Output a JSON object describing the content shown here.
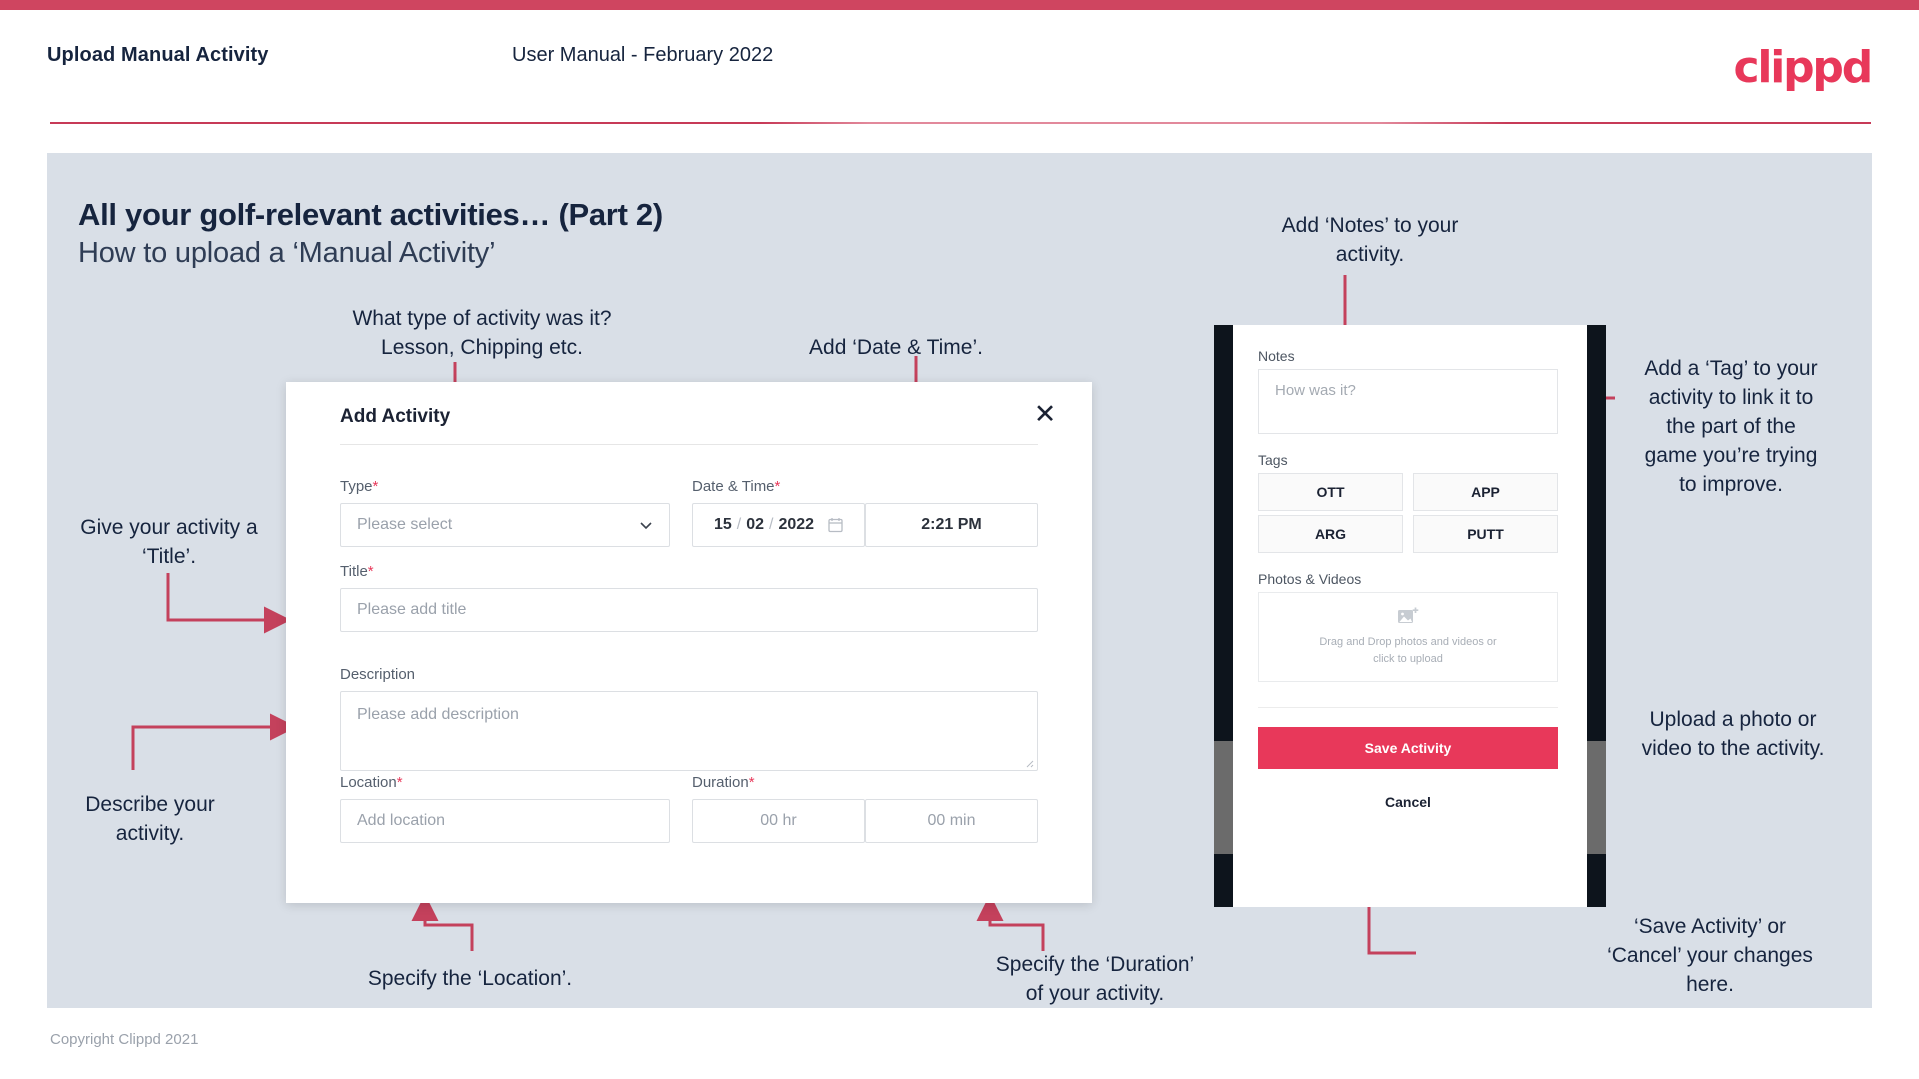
{
  "header": {
    "title": "Upload Manual Activity",
    "subtitle": "User Manual - February 2022",
    "logo": "clippd"
  },
  "slide": {
    "title": "All your golf-relevant activities… (Part 2)",
    "subtitle": "How to upload a ‘Manual Activity’"
  },
  "annotations": {
    "type": "What type of activity was it?\nLesson, Chipping etc.",
    "datetime": "Add ‘Date & Time’.",
    "title": "Give your activity a\n‘Title’.",
    "description": "Describe your\nactivity.",
    "location": "Specify the ‘Location’.",
    "duration": "Specify the ‘Duration’\nof your activity.",
    "notes": "Add ‘Notes’ to your\nactivity.",
    "tags": "Add a ‘Tag’ to your\nactivity to link it to\nthe part of the\ngame you’re trying\nto improve.",
    "upload": "Upload a photo or\nvideo to the activity.",
    "save": "‘Save Activity’ or\n‘Cancel’ your changes\nhere."
  },
  "dialog": {
    "title": "Add Activity",
    "close_icon": "close-icon",
    "fields": {
      "type": {
        "label": "Type",
        "required": "*",
        "placeholder": "Please select",
        "chevron_icon": "chevron-down-icon"
      },
      "datetime": {
        "label": "Date & Time",
        "required": "*",
        "day": "15",
        "sep1": "/",
        "month": "02",
        "sep2": "/",
        "year": "2022",
        "calendar_icon": "calendar-icon",
        "time": "2:21 PM"
      },
      "title": {
        "label": "Title",
        "required": "*",
        "placeholder": "Please add title"
      },
      "description": {
        "label": "Description",
        "required": "",
        "placeholder": "Please add description"
      },
      "location": {
        "label": "Location",
        "required": "*",
        "placeholder": "Add location"
      },
      "duration": {
        "label": "Duration",
        "required": "*",
        "hours": "00 hr",
        "minutes": "00 min"
      }
    }
  },
  "phone": {
    "notes": {
      "label": "Notes",
      "placeholder": "How was it?"
    },
    "tags": {
      "label": "Tags",
      "items": [
        "OTT",
        "APP",
        "ARG",
        "PUTT"
      ]
    },
    "photos": {
      "label": "Photos & Videos",
      "icon": "add-image-icon",
      "dropzone": "Drag and Drop photos and videos or\nclick to upload"
    },
    "save_label": "Save Activity",
    "cancel_label": "Cancel"
  },
  "footer": {
    "copyright": "Copyright Clippd 2021"
  },
  "colors": {
    "brand_pink": "#e8385a",
    "top_bar": "#cf4560",
    "slide_bg": "#d9dfe7",
    "navy_text": "#16243e",
    "connector": "#c4415c"
  }
}
